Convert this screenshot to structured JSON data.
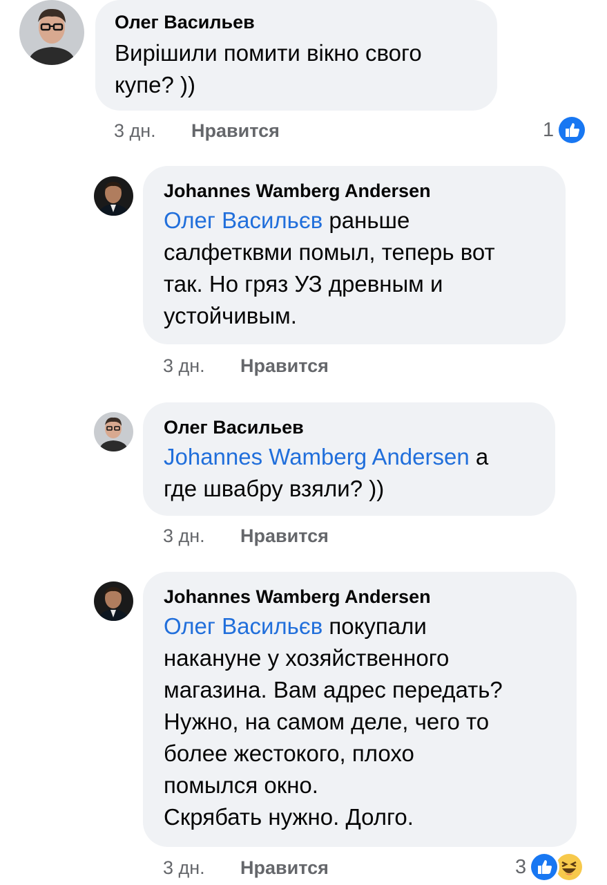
{
  "comments": [
    {
      "author": "Олег Васильев",
      "mention": "",
      "text": "Вирішили помити вікно свого\nкупе? ))",
      "time": "3 дн.",
      "like_label": "Нравится",
      "reaction_count": "1",
      "reactions": [
        "like-icon"
      ]
    },
    {
      "author": "Johannes Wamberg Andersen",
      "mention": "Олег Васильєв",
      "text": " раньше\nсалфетквми помыл, теперь вот\nтак. Но гряз УЗ древным  и\nустойчивым.",
      "time": "3 дн.",
      "like_label": "Нравится"
    },
    {
      "author": "Олег Васильев",
      "mention": "Johannes Wamberg Andersen",
      "text": " а\nгде швабру взяли? ))",
      "time": "3 дн.",
      "like_label": "Нравится"
    },
    {
      "author": "Johannes Wamberg Andersen",
      "mention": "Олег Васильєв",
      "text": " покупали\nнакануне у хозяйственного\nмагазина. Вам адрес передать?\nНужно, на самом деле, чего то\nболее жестокого, плохо\nпомылся окно.\nСкрябать нужно. Долго.",
      "time": "3 дн.",
      "like_label": "Нравится",
      "reaction_count": "3",
      "reactions": [
        "like-icon",
        "haha-icon"
      ]
    }
  ],
  "colors": {
    "bubble": "#f0f2f5",
    "mention": "#216fdb",
    "meta": "#65676b",
    "like_blue": "#1877f2",
    "haha_yellow": "#f7c94b"
  }
}
